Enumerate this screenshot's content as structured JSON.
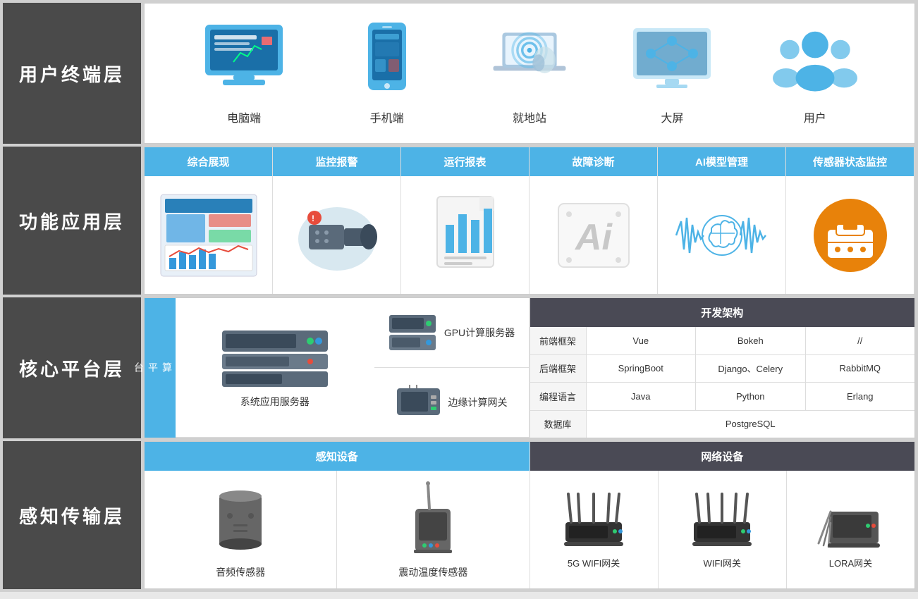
{
  "rows": [
    {
      "id": "terminal",
      "label": "用户终端层",
      "items": [
        {
          "id": "computer",
          "label": "电脑端"
        },
        {
          "id": "phone",
          "label": "手机端"
        },
        {
          "id": "station",
          "label": "就地站"
        },
        {
          "id": "bigscreen",
          "label": "大屏"
        },
        {
          "id": "users",
          "label": "用户"
        }
      ]
    },
    {
      "id": "function",
      "label": "功能应用层",
      "headers": [
        "综合展现",
        "监控报警",
        "运行报表",
        "故障诊断",
        "AI模型管理",
        "传感器状态监控"
      ]
    },
    {
      "id": "platform",
      "label": "核心平台层",
      "calc_label": "计\n算\n平\n台",
      "main_server": "系统应用服务器",
      "right_servers": [
        "GPU计算服务器",
        "边缘计算网关"
      ],
      "dev_title": "开发架构",
      "dev_rows": [
        {
          "cat": "前端框架",
          "vals": [
            "Vue",
            "Bokeh",
            "//"
          ]
        },
        {
          "cat": "后端框架",
          "vals": [
            "SpringBoot",
            "Django、Celery",
            "RabbitMQ"
          ]
        },
        {
          "cat": "编程语言",
          "vals": [
            "Java",
            "Python",
            "Erlang"
          ]
        },
        {
          "cat": "数据库",
          "vals": [
            "PostgreSQL"
          ]
        }
      ]
    },
    {
      "id": "sensor",
      "label": "感知传输层",
      "perception_header": "感知设备",
      "perception_devices": [
        {
          "id": "audio",
          "label": "音频传感器"
        },
        {
          "id": "vibration",
          "label": "震动温度传感器"
        }
      ],
      "network_header": "网络设备",
      "network_devices": [
        {
          "id": "5gwifi",
          "label": "5G WIFI网关"
        },
        {
          "id": "wifi",
          "label": "WIFI网关"
        },
        {
          "id": "lora",
          "label": "LORA网关"
        }
      ]
    }
  ],
  "colors": {
    "label_bg": "#4a4a4a",
    "header_bg": "#4db3e6",
    "dev_title_bg": "#4a4a55",
    "network_header_bg": "#4a4a55"
  }
}
